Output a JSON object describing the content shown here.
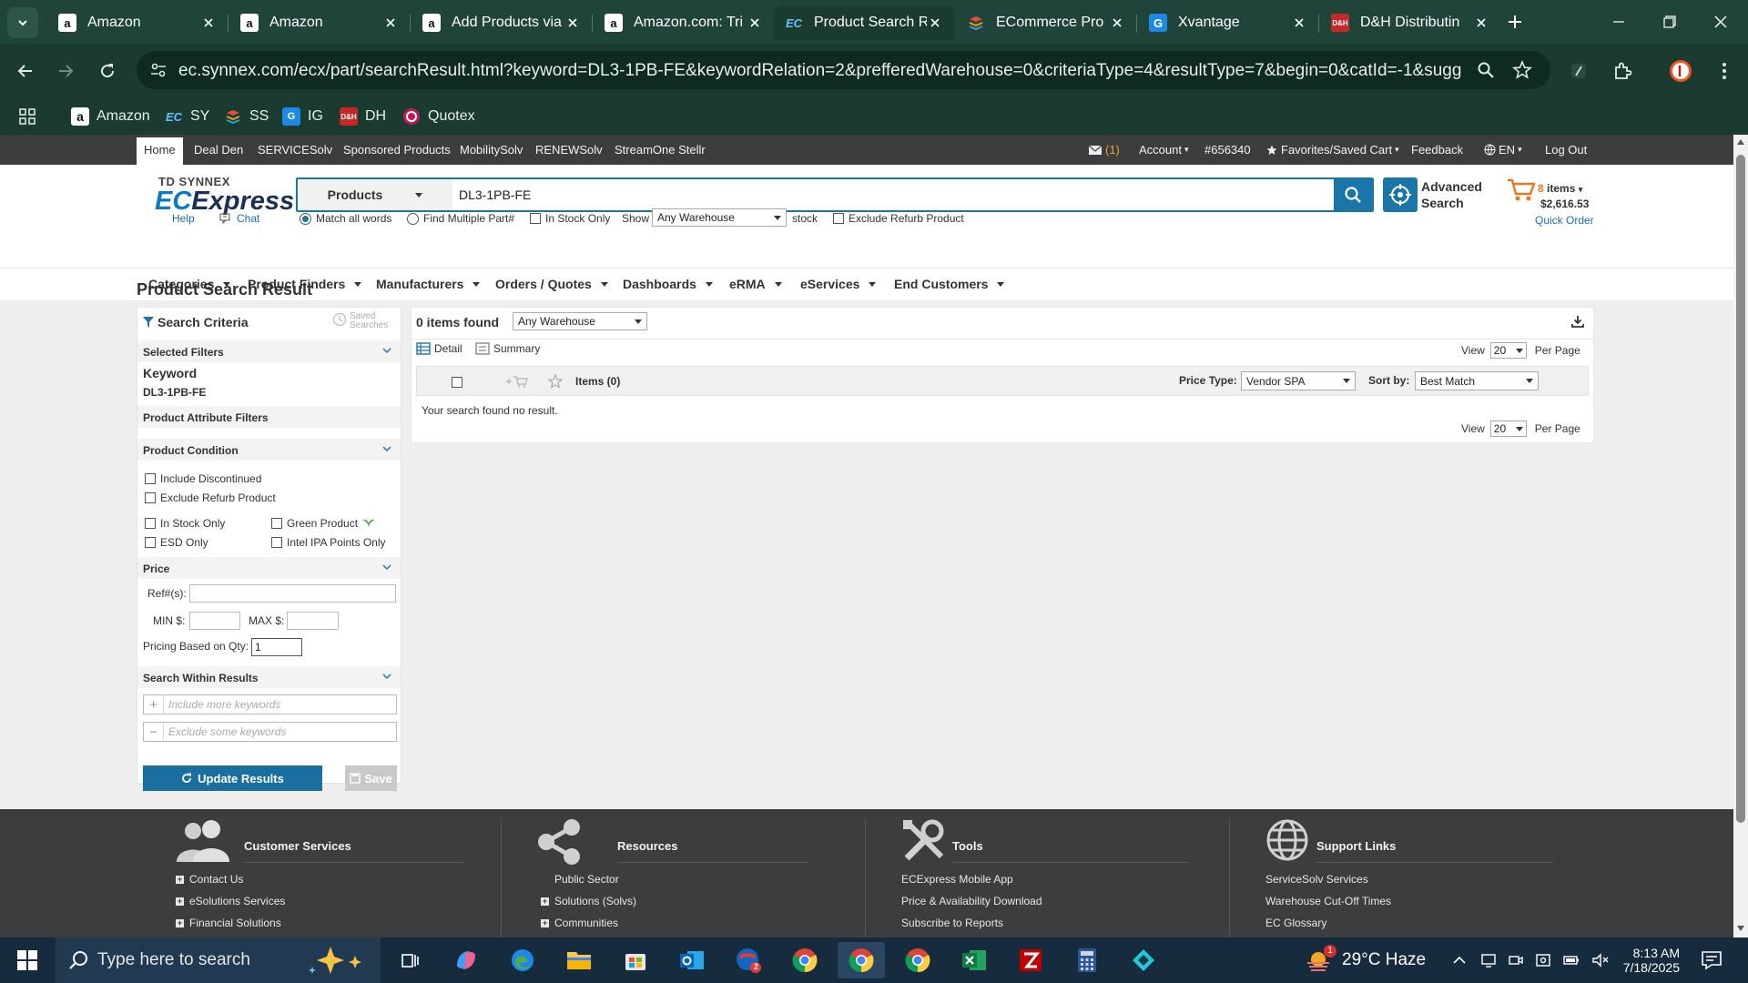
{
  "browser": {
    "tabs": [
      {
        "title": "Amazon",
        "icon": "amazon-icon"
      },
      {
        "title": "Amazon",
        "icon": "amazon-icon"
      },
      {
        "title": "Add Products via",
        "icon": "amazon-icon"
      },
      {
        "title": "Amazon.com: Tri",
        "icon": "amazon-icon"
      },
      {
        "title": "Product Search R",
        "icon": "ecexpress-icon",
        "active": true
      },
      {
        "title": "ECommerce Pro",
        "icon": "stack-icon"
      },
      {
        "title": "Xvantage",
        "icon": "xvantage-icon"
      },
      {
        "title": "D&H Distributin",
        "icon": "dh-icon"
      }
    ],
    "url": "ec.synnex.com/ecx/part/searchResult.html?keyword=DL3-1PB-FE&keywordRelation=2&prefferedWarehouse=0&criteriaType=4&resultType=7&begin=0&catId=-1&suggestionSearc...",
    "bookmarks": [
      {
        "label": "Amazon",
        "icon": "amazon-icon"
      },
      {
        "label": "SY",
        "icon": "ec-icon"
      },
      {
        "label": "SS",
        "icon": "stack-icon"
      },
      {
        "label": "IG",
        "icon": "ingram-icon"
      },
      {
        "label": "DH",
        "icon": "dh-icon"
      },
      {
        "label": "Quotex",
        "icon": "quotex-icon"
      }
    ]
  },
  "topnav": {
    "links": [
      "Home",
      "Deal Den",
      "SERVICESolv",
      "Sponsored Products",
      "MobilitySolv",
      "RENEWSolv",
      "StreamOne Stellr"
    ],
    "messages": "(1)",
    "account": "Account",
    "account_no": "#656340",
    "favorites": "Favorites/Saved Cart",
    "feedback": "Feedback",
    "language": "EN",
    "logout": "Log Out"
  },
  "header": {
    "logo_small": "TD SYNNEX",
    "logo_ec": "EC",
    "logo_express": "Express",
    "search_category": "Products",
    "search_keyword": "DL3-1PB-FE",
    "advanced_line1": "Advanced",
    "advanced_line2": "Search",
    "cart_items": "8",
    "cart_items_label": "items",
    "cart_total": "$2,616.53",
    "quick_order": "Quick Order",
    "help": "Help",
    "chat": "Chat",
    "match_all": "Match all words",
    "find_multiple": "Find Multiple Part#",
    "in_stock_only": "In Stock Only",
    "show": "Show",
    "warehouse": "Any Warehouse",
    "stock": "stock",
    "exclude_refurb": "Exclude Refurb Product"
  },
  "catnav": [
    "Categories",
    "Product Finders",
    "Manufacturers",
    "Orders / Quotes",
    "Dashboards",
    "eRMA",
    "eServices",
    "End Customers"
  ],
  "page_title": "Product Search Result",
  "left": {
    "search_criteria": "Search Criteria",
    "saved_searches_1": "Saved",
    "saved_searches_2": "Searches",
    "selected_filters": "Selected Filters",
    "keyword_label": "Keyword",
    "keyword_value": "DL3-1PB-FE",
    "product_attribute_filters": "Product Attribute Filters",
    "product_condition": "Product Condition",
    "include_discontinued": "Include Discontinued",
    "exclude_refurb": "Exclude Refurb Product",
    "in_stock_only": "In Stock Only",
    "green_product": "Green Product",
    "esd_only": "ESD Only",
    "intel_ipa": "Intel IPA Points Only",
    "price": "Price",
    "ref_label": "Ref#(s):",
    "min_label": "MIN $:",
    "max_label": "MAX $:",
    "pricing_qty_label": "Pricing Based on Qty:",
    "pricing_qty_value": "1",
    "search_within": "Search Within Results",
    "include_placeholder": "Include more keywords",
    "exclude_placeholder": "Exclude some keywords",
    "update_results": "Update Results",
    "save": "Save"
  },
  "results": {
    "count": "0 items found",
    "warehouse": "Any Warehouse",
    "detail": "Detail",
    "summary": "Summary",
    "view": "View",
    "per_page_value": "20",
    "per_page": "Per Page",
    "items": "Items (0)",
    "price_type_label": "Price Type:",
    "price_type": "Vendor SPA",
    "sort_label": "Sort by:",
    "sort": "Best Match",
    "no_result": "Your search found no result."
  },
  "footer": {
    "columns": [
      {
        "title": "Customer Services",
        "icon": "people-icon",
        "links": [
          "Contact Us",
          "eSolutions Services",
          "Financial Solutions"
        ],
        "expandable": [
          true,
          true,
          true
        ]
      },
      {
        "title": "Resources",
        "icon": "share-icon",
        "links": [
          "Public Sector",
          "Solutions (Solvs)",
          "Communities"
        ],
        "expandable": [
          false,
          true,
          true
        ]
      },
      {
        "title": "Tools",
        "icon": "tools-icon",
        "links": [
          "ECExpress Mobile App",
          "Price & Availability Download",
          "Subscribe to Reports"
        ],
        "expandable": [
          false,
          false,
          false
        ]
      },
      {
        "title": "Support Links",
        "icon": "globe-icon",
        "links": [
          "ServiceSolv Services",
          "Warehouse Cut-Off Times",
          "EC Glossary"
        ],
        "expandable": [
          false,
          false,
          false
        ]
      }
    ]
  },
  "taskbar": {
    "search_placeholder": "Type here to search",
    "weather_badge": "1",
    "weather": "29°C Haze",
    "time": "8:13 AM",
    "date": "7/18/2025",
    "outlook_badge": "2",
    "apps": [
      "task-view-icon",
      "copilot-icon",
      "edge-icon",
      "file-explorer-icon",
      "store-icon",
      "outlook-icon",
      "app-icon",
      "chrome-icon",
      "chrome-icon",
      "chrome-icon",
      "excel-icon",
      "filezilla-icon",
      "calculator-icon",
      "app-icon"
    ]
  },
  "colors": {
    "chrome_dark": "#1b3a30",
    "tab_bar": "#20443a",
    "accent_blue": "#1a75a8",
    "footer": "#3b3d3f",
    "taskbar": "#162b3d"
  }
}
